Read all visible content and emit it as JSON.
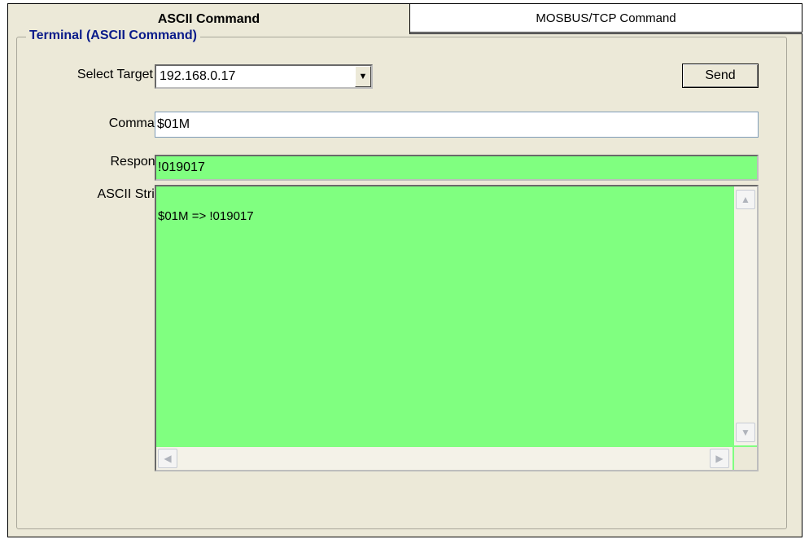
{
  "tabs": [
    {
      "label": "ASCII Command",
      "active": true
    },
    {
      "label": "MOSBUS/TCP Command",
      "active": false
    }
  ],
  "group": {
    "title": "Terminal (ASCII Command)"
  },
  "target_ip": {
    "label": "Select Target IP:",
    "value": "192.168.0.17"
  },
  "send_button": {
    "label": "Send"
  },
  "command": {
    "label": "Command:",
    "value": "$01M"
  },
  "response": {
    "label": "Response:",
    "value": "!019017"
  },
  "ascii_string": {
    "label": "ASCII String:",
    "lines": [
      "$01M => !019017"
    ]
  },
  "icons": {
    "dropdown": "chevron-down-icon",
    "scroll_up": "chevron-up-icon",
    "scroll_down": "chevron-down-icon",
    "scroll_left": "chevron-left-icon",
    "scroll_right": "chevron-right-icon"
  },
  "colors": {
    "response_bg": "#80ff80",
    "group_title": "#0a1b8a",
    "panel_bg": "#ece9d8"
  }
}
